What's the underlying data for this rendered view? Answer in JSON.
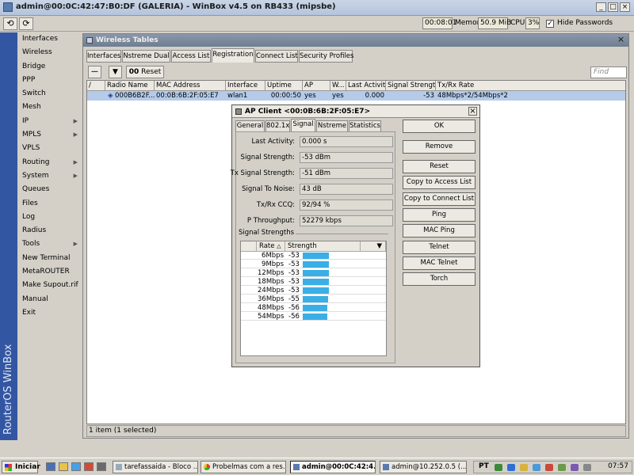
{
  "window": {
    "title": "admin@00:0C:42:47:B0:DF (GALERIA) - WinBox v4.5 on RB433 (mipsbe)",
    "minimize": "_",
    "maximize": "□",
    "close": "×"
  },
  "toolbar": {
    "undo_icon": "⟲",
    "redo_icon": "⟳",
    "uptime": "00:08:01",
    "memory_label": "Memory:",
    "memory": "50.9 MiB",
    "cpu_label": "CPU:",
    "cpu": "3%",
    "hide_passwords": "Hide Passwords"
  },
  "sidebar": {
    "brand": "RouterOS WinBox",
    "items": [
      {
        "label": "Interfaces",
        "arrow": ""
      },
      {
        "label": "Wireless",
        "arrow": ""
      },
      {
        "label": "Bridge",
        "arrow": ""
      },
      {
        "label": "PPP",
        "arrow": ""
      },
      {
        "label": "Switch",
        "arrow": ""
      },
      {
        "label": "Mesh",
        "arrow": ""
      },
      {
        "label": "IP",
        "arrow": "▶"
      },
      {
        "label": "MPLS",
        "arrow": "▶"
      },
      {
        "label": "VPLS",
        "arrow": ""
      },
      {
        "label": "Routing",
        "arrow": "▶"
      },
      {
        "label": "System",
        "arrow": "▶"
      },
      {
        "label": "Queues",
        "arrow": ""
      },
      {
        "label": "Files",
        "arrow": ""
      },
      {
        "label": "Log",
        "arrow": ""
      },
      {
        "label": "Radius",
        "arrow": ""
      },
      {
        "label": "Tools",
        "arrow": "▶"
      },
      {
        "label": "New Terminal",
        "arrow": ""
      },
      {
        "label": "MetaROUTER",
        "arrow": ""
      },
      {
        "label": "Make Supout.rif",
        "arrow": ""
      },
      {
        "label": "Manual",
        "arrow": ""
      },
      {
        "label": "Exit",
        "arrow": ""
      }
    ]
  },
  "wireless_tables": {
    "title": "Wireless Tables",
    "close": "×",
    "tabs": [
      "Interfaces",
      "Nstreme Dual",
      "Access List",
      "Registration",
      "Connect List",
      "Security Profiles"
    ],
    "active_tab": "Registration",
    "remove_icon": "—",
    "filter_icon": "▼",
    "reset_label": "Reset",
    "reset_prefix": "00",
    "find_placeholder": "Find",
    "columns": [
      "Radio Name",
      "MAC Address",
      "Interface",
      "Uptime",
      "AP",
      "W...",
      "Last Activit...",
      "Signal Strengt...",
      "Tx/Rx Rate"
    ],
    "column_marker": "/",
    "row": {
      "icon": "◈",
      "radio_name": "000B6B2F...",
      "mac": "00:0B:6B:2F:05:E7",
      "interface": "wlan1",
      "uptime": "00:00:50",
      "ap": "yes",
      "w": "yes",
      "last_activity": "0.000",
      "signal": "-53",
      "rate": "48Mbps*2/54Mbps*2"
    },
    "status": "1 item (1 selected)"
  },
  "ap_client": {
    "title": "AP Client <00:0B:6B:2F:05:E7>",
    "close": "×",
    "tabs": [
      "General",
      "802.1x",
      "Signal",
      "Nstreme",
      "Statistics"
    ],
    "active_tab": "Signal",
    "fields": [
      {
        "label": "Last Activity:",
        "value": "0.000 s"
      },
      {
        "label": "Signal Strength:",
        "value": "-53 dBm"
      },
      {
        "label": "Tx Signal Strength:",
        "value": "-51 dBm"
      },
      {
        "label": "Signal To Noise:",
        "value": "43 dB"
      },
      {
        "label": "Tx/Rx CCQ:",
        "value": "92/94 %"
      },
      {
        "label": "P Throughput:",
        "value": "52279 kbps"
      }
    ],
    "section": "Signal Strengths",
    "grid_cols": [
      "Rate",
      "Strength"
    ],
    "sort_icon": "△",
    "dropdown_icon": "▼",
    "strengths": [
      {
        "rate": "6Mbps",
        "value": "-53",
        "level": 0.92
      },
      {
        "rate": "9Mbps",
        "value": "-53",
        "level": 0.92
      },
      {
        "rate": "12Mbps",
        "value": "-53",
        "level": 0.92
      },
      {
        "rate": "18Mbps",
        "value": "-53",
        "level": 0.92
      },
      {
        "rate": "24Mbps",
        "value": "-53",
        "level": 0.92
      },
      {
        "rate": "36Mbps",
        "value": "-55",
        "level": 0.88
      },
      {
        "rate": "48Mbps",
        "value": "-56",
        "level": 0.86
      },
      {
        "rate": "54Mbps",
        "value": "-56",
        "level": 0.86
      }
    ],
    "buttons": [
      "OK",
      "Remove",
      "Reset",
      "Copy to Access List",
      "Copy to Connect List",
      "Ping",
      "MAC Ping",
      "Telnet",
      "MAC Telnet",
      "Torch"
    ]
  },
  "taskbar": {
    "start": "Iniciar",
    "tasks": [
      {
        "label": "tarefassaida - Bloco ...",
        "active": false
      },
      {
        "label": "Probelmas com a res...",
        "active": false
      },
      {
        "label": "admin@00:0C:42:4...",
        "active": true
      },
      {
        "label": "admin@10.252.0.5 (...",
        "active": false
      }
    ],
    "lang": "PT",
    "time": "07:57"
  }
}
